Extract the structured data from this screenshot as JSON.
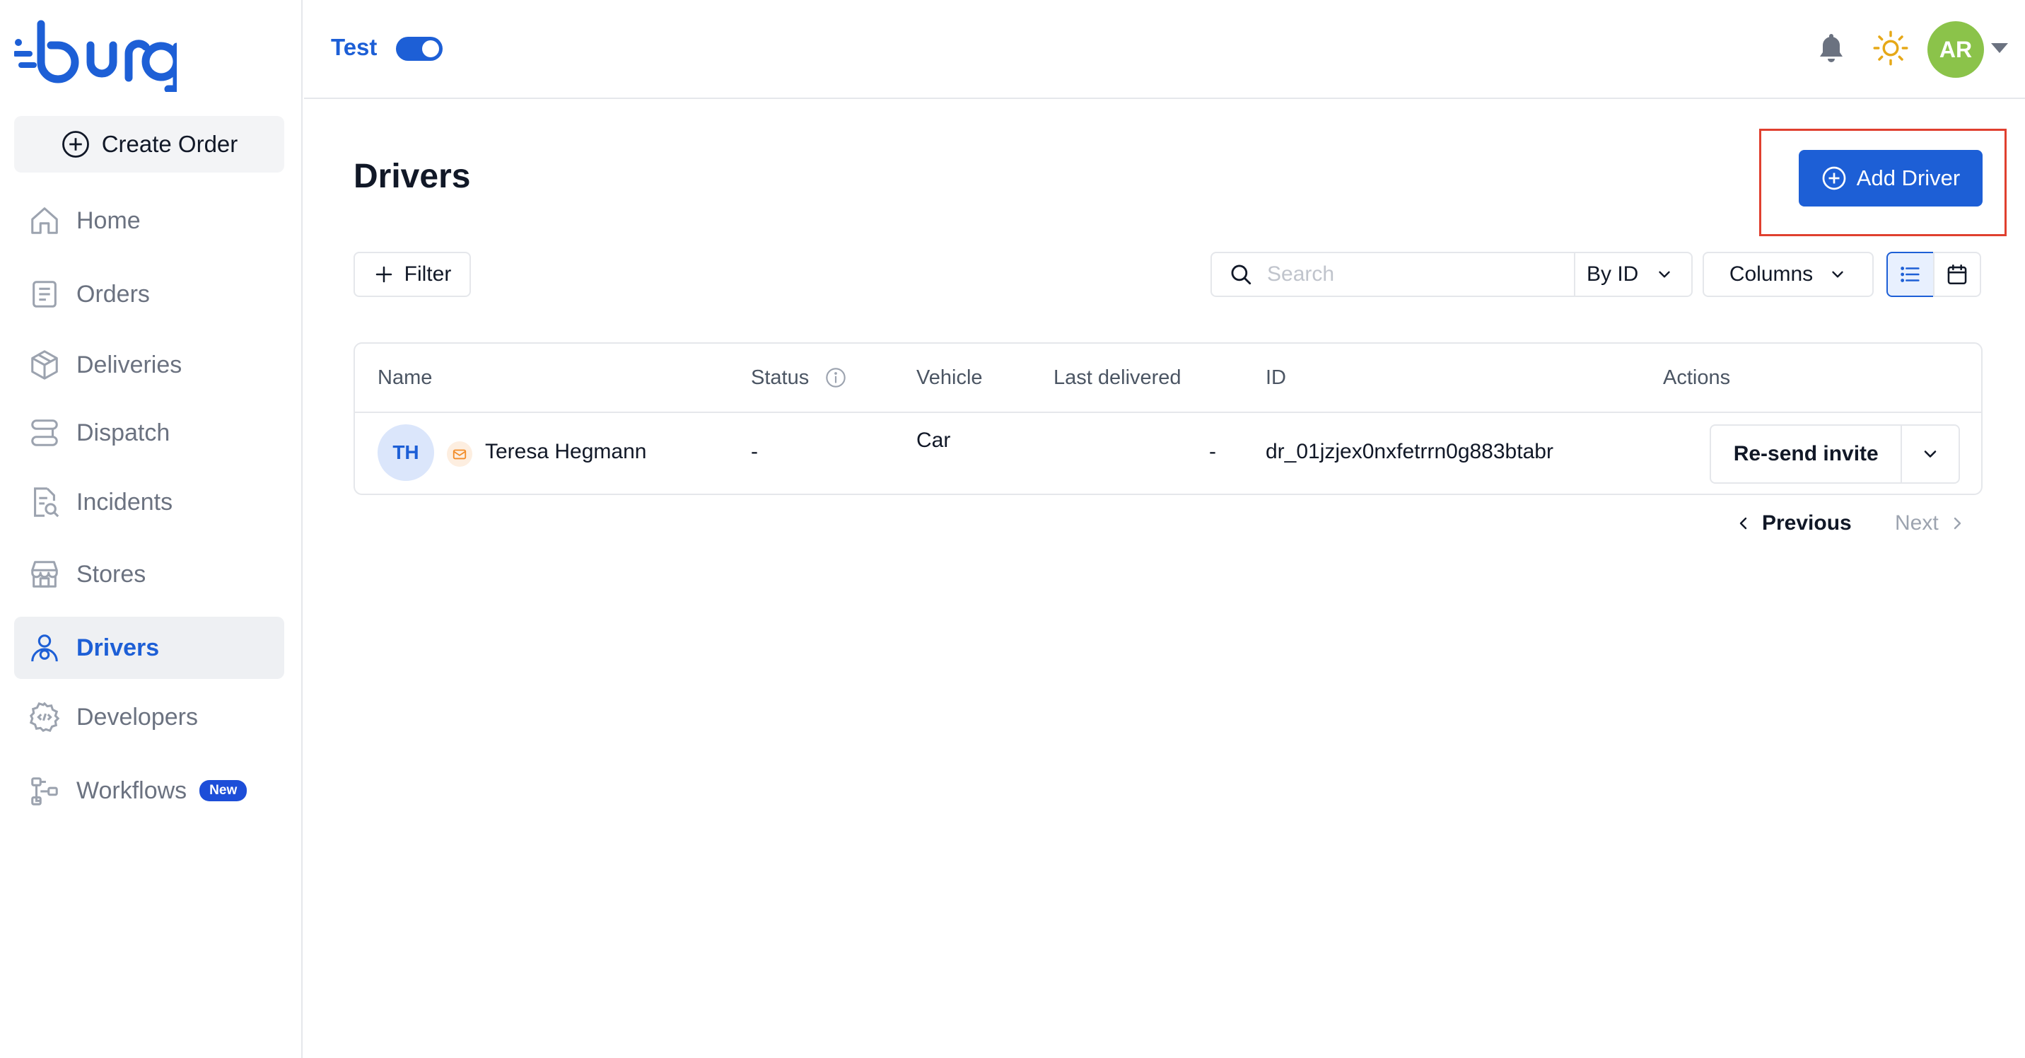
{
  "app": {
    "logo_text": "burq"
  },
  "sidebar": {
    "create_order_label": "Create Order",
    "items": [
      {
        "label": "Home",
        "icon": "home-icon"
      },
      {
        "label": "Orders",
        "icon": "orders-icon"
      },
      {
        "label": "Deliveries",
        "icon": "package-icon"
      },
      {
        "label": "Dispatch",
        "icon": "route-icon"
      },
      {
        "label": "Incidents",
        "icon": "incident-report-icon"
      },
      {
        "label": "Stores",
        "icon": "store-icon"
      },
      {
        "label": "Drivers",
        "icon": "driver-icon",
        "active": true
      },
      {
        "label": "Developers",
        "icon": "developer-gear-icon"
      },
      {
        "label": "Workflows",
        "icon": "workflow-icon",
        "badge": "New"
      }
    ]
  },
  "header": {
    "env_label": "Test",
    "env_toggle_on": true,
    "avatar_initials": "AR",
    "avatar_color": "#8bc34a"
  },
  "main": {
    "title": "Drivers",
    "add_button_label": "Add Driver",
    "filter_label": "Filter",
    "search_placeholder": "Search",
    "search_by_label": "By ID",
    "columns_label": "Columns",
    "table": {
      "headers": [
        "Name",
        "Status",
        "Vehicle",
        "Last delivered",
        "ID",
        "Actions"
      ],
      "rows": [
        {
          "initials": "TH",
          "name": "Teresa Hegmann",
          "status": "-",
          "vehicle": "Car",
          "last_delivered": "-",
          "id": "dr_01jzjex0nxfetrrn0g883btabr",
          "action_label": "Re-send invite"
        }
      ]
    },
    "pagination": {
      "previous": "Previous",
      "next": "Next"
    }
  },
  "colors": {
    "brand_blue": "#1d5fd6",
    "highlight_red": "#e0402f",
    "badge_blue": "#1d4ed8"
  }
}
